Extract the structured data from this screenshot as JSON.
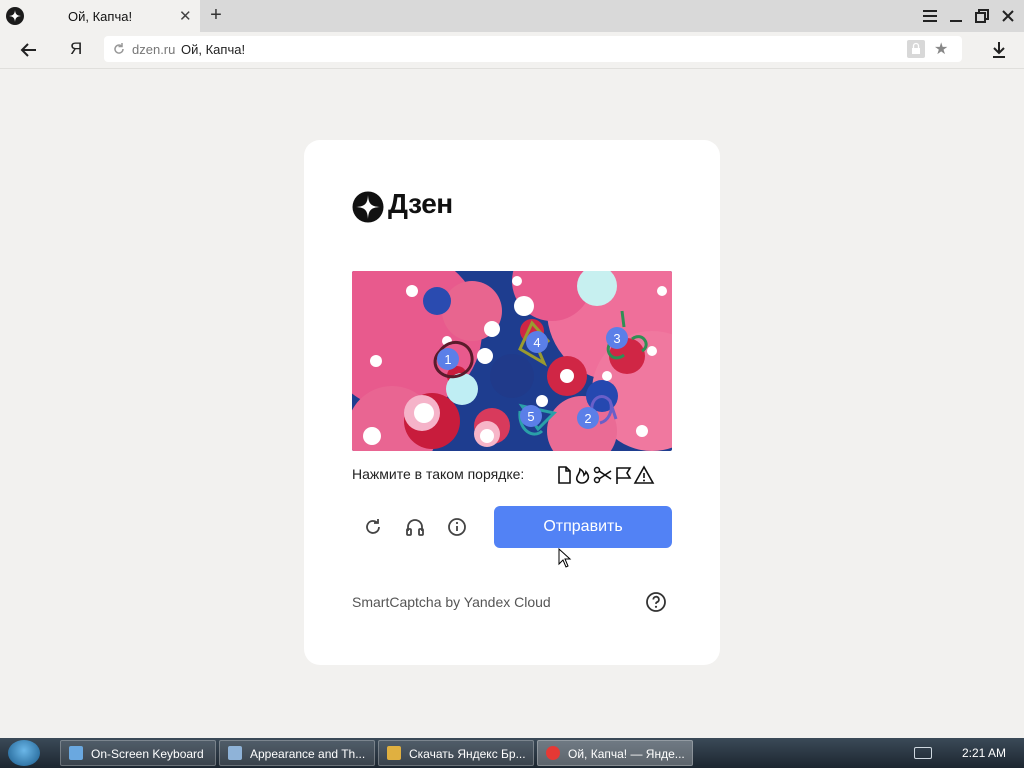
{
  "browser": {
    "tab_title": "Ой, Капча!",
    "tab_close": "✕",
    "new_tab": "+",
    "logo_letter": "Я",
    "address_host": "dzen.ru",
    "address_title": "Ой, Капча!"
  },
  "card": {
    "brand": "Дзен",
    "instruction": "Нажмите в таком порядке:",
    "submit_label": "Отправить",
    "footer": "SmartCaptcha by Yandex Cloud",
    "markers": [
      "1",
      "2",
      "3",
      "4",
      "5"
    ]
  },
  "taskbar": {
    "items": [
      {
        "label": "On-Screen Keyboard"
      },
      {
        "label": "Appearance and Th..."
      },
      {
        "label": "Скачать Яндекс Бр..."
      },
      {
        "label": "Ой, Капча! — Янде..."
      }
    ],
    "clock": "2:21 AM"
  },
  "colors": {
    "accent": "#5282f5",
    "marker": "#5b7fe8"
  }
}
